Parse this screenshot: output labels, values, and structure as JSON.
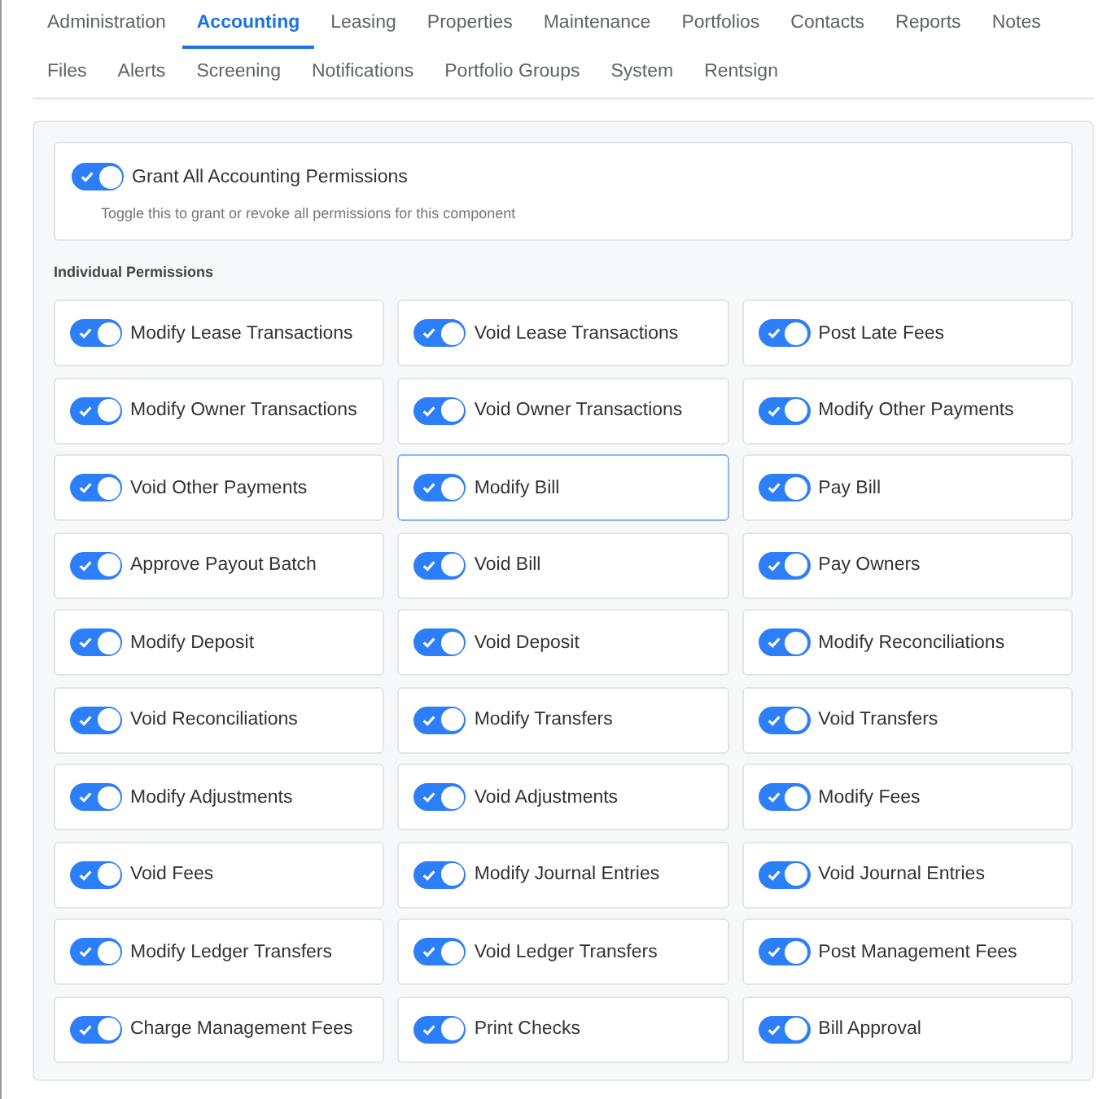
{
  "tabs": [
    {
      "label": "Administration",
      "selected": false
    },
    {
      "label": "Accounting",
      "selected": true
    },
    {
      "label": "Leasing",
      "selected": false
    },
    {
      "label": "Properties",
      "selected": false
    },
    {
      "label": "Maintenance",
      "selected": false
    },
    {
      "label": "Portfolios",
      "selected": false
    },
    {
      "label": "Contacts",
      "selected": false
    },
    {
      "label": "Reports",
      "selected": false
    },
    {
      "label": "Notes",
      "selected": false
    },
    {
      "label": "Files",
      "selected": false
    },
    {
      "label": "Alerts",
      "selected": false
    },
    {
      "label": "Screening",
      "selected": false
    },
    {
      "label": "Notifications",
      "selected": false
    },
    {
      "label": "Portfolio Groups",
      "selected": false
    },
    {
      "label": "System",
      "selected": false
    },
    {
      "label": "Rentsign",
      "selected": false
    }
  ],
  "grant_all": {
    "label": "Grant All Accounting Permissions",
    "on": true,
    "description": "Toggle this to grant or revoke all permissions for this component"
  },
  "section_title": "Individual Permissions",
  "permissions": [
    {
      "label": "Modify Lease Transactions",
      "on": true,
      "selected": false
    },
    {
      "label": "Void Lease Transactions",
      "on": true,
      "selected": false
    },
    {
      "label": "Post Late Fees",
      "on": true,
      "selected": false
    },
    {
      "label": "Modify Owner Transactions",
      "on": true,
      "selected": false
    },
    {
      "label": "Void Owner Transactions",
      "on": true,
      "selected": false
    },
    {
      "label": "Modify Other Payments",
      "on": true,
      "selected": false
    },
    {
      "label": "Void Other Payments",
      "on": true,
      "selected": false
    },
    {
      "label": "Modify Bill",
      "on": true,
      "selected": true
    },
    {
      "label": "Pay Bill",
      "on": true,
      "selected": false
    },
    {
      "label": "Approve Payout Batch",
      "on": true,
      "selected": false
    },
    {
      "label": "Void Bill",
      "on": true,
      "selected": false
    },
    {
      "label": "Pay Owners",
      "on": true,
      "selected": false
    },
    {
      "label": "Modify Deposit",
      "on": true,
      "selected": false
    },
    {
      "label": "Void Deposit",
      "on": true,
      "selected": false
    },
    {
      "label": "Modify Reconciliations",
      "on": true,
      "selected": false
    },
    {
      "label": "Void Reconciliations",
      "on": true,
      "selected": false
    },
    {
      "label": "Modify Transfers",
      "on": true,
      "selected": false
    },
    {
      "label": "Void Transfers",
      "on": true,
      "selected": false
    },
    {
      "label": "Modify Adjustments",
      "on": true,
      "selected": false
    },
    {
      "label": "Void Adjustments",
      "on": true,
      "selected": false
    },
    {
      "label": "Modify Fees",
      "on": true,
      "selected": false
    },
    {
      "label": "Void Fees",
      "on": true,
      "selected": false
    },
    {
      "label": "Modify Journal Entries",
      "on": true,
      "selected": false
    },
    {
      "label": "Void Journal Entries",
      "on": true,
      "selected": false
    },
    {
      "label": "Modify Ledger Transfers",
      "on": true,
      "selected": false
    },
    {
      "label": "Void Ledger Transfers",
      "on": true,
      "selected": false
    },
    {
      "label": "Post Management Fees",
      "on": true,
      "selected": false
    },
    {
      "label": "Charge Management Fees",
      "on": true,
      "selected": false
    },
    {
      "label": "Print Checks",
      "on": true,
      "selected": false
    },
    {
      "label": "Bill Approval",
      "on": true,
      "selected": false
    }
  ]
}
